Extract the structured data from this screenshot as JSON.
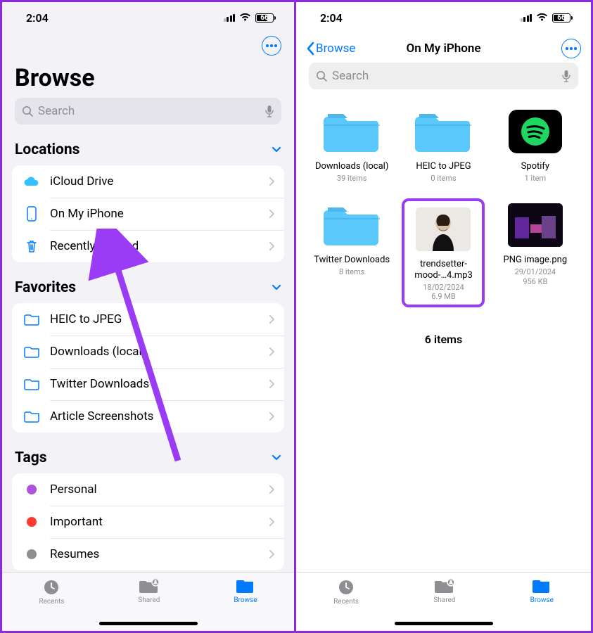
{
  "status": {
    "time": "2:04",
    "battery": "66"
  },
  "screen1": {
    "title": "Browse",
    "search_placeholder": "Search",
    "sections": {
      "locations": {
        "header": "Locations",
        "items": [
          {
            "label": "iCloud Drive"
          },
          {
            "label": "On My iPhone"
          },
          {
            "label": "Recently Deleted"
          }
        ]
      },
      "favorites": {
        "header": "Favorites",
        "items": [
          {
            "label": "HEIC to JPEG"
          },
          {
            "label": "Downloads (local)"
          },
          {
            "label": "Twitter Downloads"
          },
          {
            "label": "Article Screenshots"
          }
        ]
      },
      "tags": {
        "header": "Tags",
        "items": [
          {
            "label": "Personal",
            "color": "#af52de"
          },
          {
            "label": "Important",
            "color": "#ff3b30"
          },
          {
            "label": "Resumes",
            "color": "#8e8e93"
          }
        ]
      }
    }
  },
  "screen2": {
    "back": "Browse",
    "title": "On My iPhone",
    "search_placeholder": "Search",
    "items": [
      {
        "name": "Downloads (local)",
        "meta": "39 items",
        "kind": "folder"
      },
      {
        "name": "HEIC to JPEG",
        "meta": "0 items",
        "kind": "folder"
      },
      {
        "name": "Spotify",
        "meta": "1 item",
        "kind": "app"
      },
      {
        "name": "Twitter Downloads",
        "meta": "8 items",
        "kind": "folder"
      },
      {
        "name": "trendsetter-mood-…4.mp3",
        "meta1": "18/02/2024",
        "meta2": "6.9 MB",
        "kind": "file-person",
        "highlight": true
      },
      {
        "name": "PNG image.png",
        "meta1": "29/01/2024",
        "meta2": "956 KB",
        "kind": "file-game"
      }
    ],
    "footer": "6 items"
  },
  "tabs": {
    "recents": "Recents",
    "shared": "Shared",
    "browse": "Browse"
  }
}
